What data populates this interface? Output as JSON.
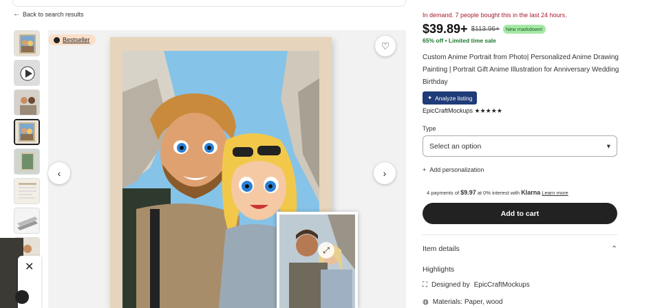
{
  "nav": {
    "back_label": "Back to search results"
  },
  "gallery": {
    "badge_label": "Bestseller",
    "thumb_count": 8,
    "active_thumb": 4
  },
  "listing": {
    "demand_text": "In demand. 7 people bought this in the last 24 hours.",
    "price": "$39.89+",
    "original_price": "$113.96+",
    "markdown_badge": "New markdown!",
    "sale_text": "65% off • Limited time sale",
    "title": "Custom Anime Portrait from Photo| Personalized Anime Drawing Painting | Portrait Gift Anime Illustration for Anniversary Wedding Birthday",
    "analyze_label": "Analyze listing",
    "shop_name": "EpicCraftMockups",
    "stars": "★★★★★",
    "rating": 5,
    "type_label": "Type",
    "type_placeholder": "Select an option",
    "personalization_label": "Add personalization",
    "klarna_prefix": "4 payments of ",
    "klarna_amount": "$9.97",
    "klarna_suffix": " at 0% interest with ",
    "klarna_brand": "Klarna",
    "klarna_learn": "Learn more",
    "cart_label": "Add to cart",
    "details_label": "Item details",
    "highlights_label": "Highlights",
    "designed_prefix": "Designed by ",
    "designed_by": "EpicCraftMockups",
    "materials": "Materials: Paper, wood"
  },
  "colors": {
    "demand": "#a61a2e",
    "sale": "#1b7a2c",
    "badge": "#fcdfc9",
    "cart": "#222222",
    "analyze": "#1f3c78"
  }
}
